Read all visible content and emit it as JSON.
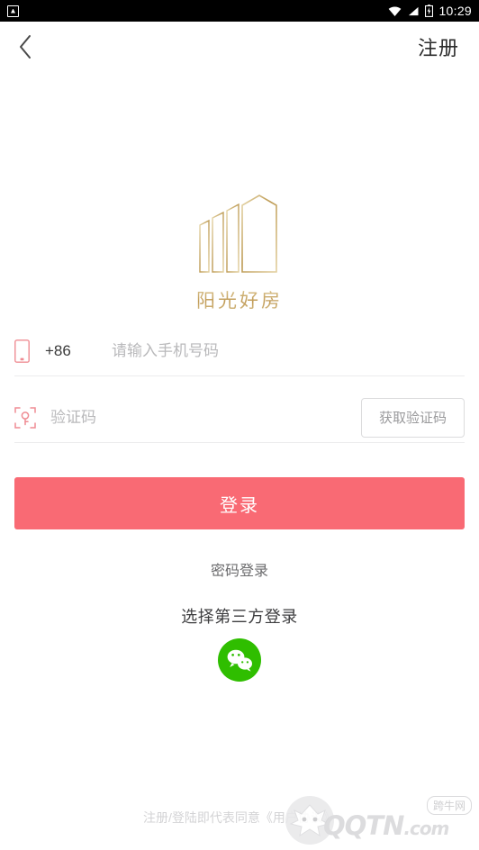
{
  "status_bar": {
    "notification_icon": "app-notification-icon",
    "wifi_icon": "wifi-icon",
    "signal_icon": "signal-icon",
    "battery_icon": "battery-charging-icon",
    "time": "10:29"
  },
  "nav": {
    "back_icon": "chevron-left-icon",
    "title": "注册"
  },
  "logo": {
    "mark_name": "sunshine-house-building-logo",
    "brand_text": "阳光好房",
    "color": "#c09a55"
  },
  "form": {
    "phone": {
      "icon": "mobile-phone-icon",
      "country_code": "+86",
      "placeholder": "请输入手机号码",
      "value": ""
    },
    "code": {
      "icon": "scan-code-icon",
      "placeholder": "验证码",
      "value": "",
      "get_code_label": "获取验证码"
    }
  },
  "actions": {
    "login_label": "登录",
    "login_color": "#f96a74",
    "password_login_label": "密码登录",
    "third_party_label": "选择第三方登录",
    "wechat": {
      "icon": "wechat-icon",
      "color": "#2fbe00"
    }
  },
  "footer": {
    "agreement_text": "注册/登陆即代表同意《用户协议》"
  },
  "watermark": {
    "brand_tag": "跨牛网",
    "site": "QQTN",
    "domain": ".com"
  }
}
